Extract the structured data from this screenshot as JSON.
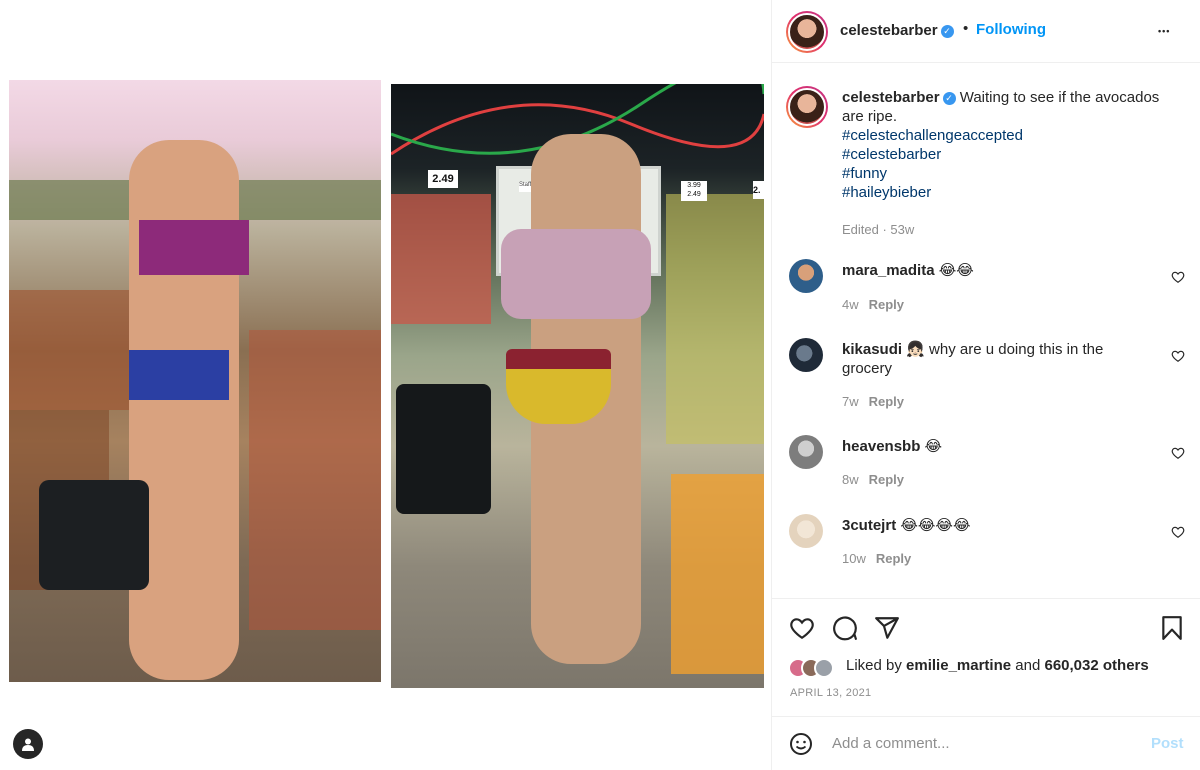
{
  "post": {
    "author": "celestebarber",
    "follow_label": "Following",
    "dot": "•",
    "more": "•••",
    "caption_text": "Waiting to see if the avocados are ripe.",
    "hashtags": [
      "#celestechallengeaccepted",
      "#celestebarber",
      "#funny",
      "#haileybieber"
    ],
    "edited": "Edited · 53w"
  },
  "comments": [
    {
      "user": "mara_madita",
      "text": "😂😂",
      "age": "4w",
      "reply": "Reply"
    },
    {
      "user": "kikasudi",
      "text": "👧🏻 why are u doing this in the grocery",
      "age": "7w",
      "reply": "Reply"
    },
    {
      "user": "heavensbb",
      "text": "😂",
      "age": "8w",
      "reply": "Reply"
    },
    {
      "user": "3cutejrt",
      "text": "😂😂😂😂",
      "age": "10w",
      "reply": "Reply"
    }
  ],
  "likes": {
    "prefix": "Liked by",
    "user": "emilie_martine",
    "and": "and",
    "others": "660,032 others"
  },
  "date": "APRIL 13, 2021",
  "add_comment": {
    "placeholder": "Add a comment...",
    "post_label": "Post"
  },
  "price_tags": {
    "left": "2.49",
    "right_top": "3.99",
    "right_bottom": "2.49",
    "edge": "2."
  },
  "sign": "Staff Only",
  "colors": {
    "link": "#00376b",
    "accent": "#0095f6",
    "post_disabled": "#b2dffc",
    "muted": "#8e8e8e"
  },
  "icons": [
    "verified-badge-icon",
    "more-options-icon",
    "heart-icon",
    "comment-icon",
    "share-icon",
    "bookmark-icon",
    "emoji-icon",
    "user-tag-icon"
  ]
}
